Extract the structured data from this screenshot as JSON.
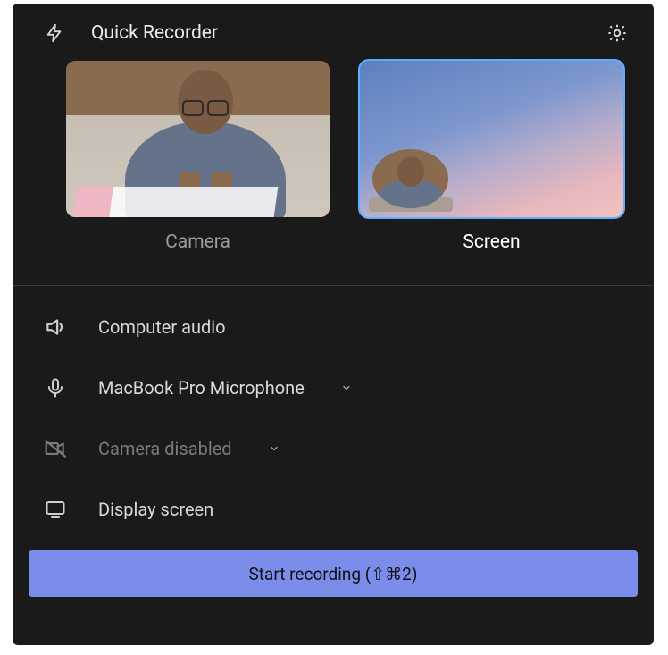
{
  "header": {
    "title": "Quick Recorder"
  },
  "modes": {
    "camera": {
      "label": "Camera",
      "selected": false
    },
    "screen": {
      "label": "Screen",
      "selected": true
    }
  },
  "options": {
    "audio": {
      "label": "Computer audio"
    },
    "mic": {
      "label": "MacBook Pro Microphone"
    },
    "camera": {
      "label": "Camera disabled"
    },
    "display": {
      "label": "Display screen"
    }
  },
  "start_button": {
    "label": "Start recording (⇧⌘2)"
  }
}
